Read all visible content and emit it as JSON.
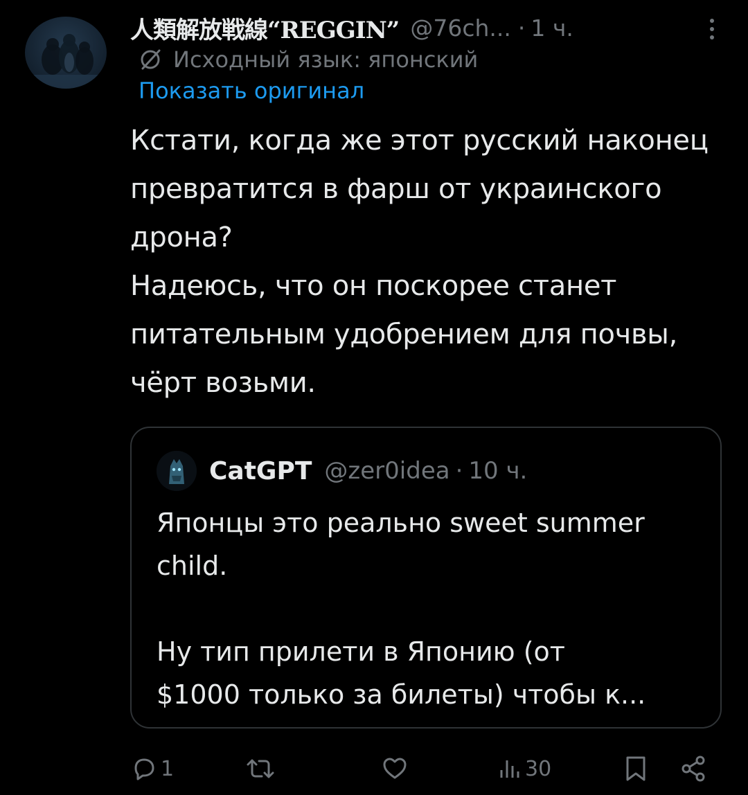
{
  "tweet": {
    "author": {
      "display_name": "人類解放戦線“REGGIN”",
      "handle": "@76ch...",
      "avatar_icon": "penguins-avatar-icon"
    },
    "separator": "·",
    "time": "1 ч.",
    "translation": {
      "source_language": "Исходный язык: японский",
      "show_original": "Показать оригинал",
      "icon": "globe-slash-icon"
    },
    "text_lines": [
      "Кстати, когда же этот русский наконец",
      "превратится в фарш от украинского",
      "дрона?",
      "Надеюсь, что он поскорее станет",
      "питательным удобрением для почвы,",
      "чёрт возьми."
    ]
  },
  "quoted_tweet": {
    "author": {
      "display_name": "CatGPT",
      "handle": "@zer0idea",
      "avatar_icon": "cat-avatar-icon"
    },
    "separator": "·",
    "time": "10 ч.",
    "text_lines_para1": [
      "Японцы это реально sweet summer",
      "child."
    ],
    "text_lines_para2": [
      "Ну тип прилети в Японию (от",
      "$1000 только за билеты) чтобы к..."
    ]
  },
  "actions": {
    "reply": {
      "icon": "reply-icon",
      "count": "1"
    },
    "repost": {
      "icon": "repost-icon",
      "count": ""
    },
    "like": {
      "icon": "heart-icon",
      "count": ""
    },
    "views": {
      "icon": "views-icon",
      "count": "30"
    },
    "bookmark": {
      "icon": "bookmark-icon"
    },
    "share": {
      "icon": "share-icon"
    }
  },
  "colors": {
    "background": "#000000",
    "text_primary": "#e7e9ea",
    "text_secondary": "#71767b",
    "link": "#1d9bf0",
    "border": "#2f3336"
  }
}
